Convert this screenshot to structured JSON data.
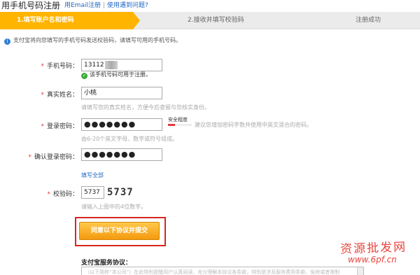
{
  "header": {
    "title": "用手机号码注册",
    "email_link": "用Email注册",
    "separator": "|",
    "help_link": "使用遇到问题?"
  },
  "steps": [
    {
      "label": "1.填写账户名和密码",
      "active": true
    },
    {
      "label": "2.接收并填写校验码",
      "active": false
    },
    {
      "label": "注册成功",
      "active": false
    }
  ],
  "notice": {
    "icon": "info-icon",
    "text": "支付宝将向您填写的手机号码发送校验码，请填写可用的手机号码。"
  },
  "form": {
    "phone": {
      "label": "手机号码：",
      "value": "13112",
      "ok_text": "该手机号码可用于注册。"
    },
    "name": {
      "label": "真实姓名：",
      "value": "小桃",
      "hint": "请填写您的真实姓名，方便今后查留与您核实身份。"
    },
    "password": {
      "label": "登录密码：",
      "value": "●●●●●●●",
      "strength_label": "安全程度",
      "strength_level": 0.3,
      "hint_side": "建议您增加密码字数并使用中英文混合的密码。",
      "hint": "由6-20个英文字母、数字或符号组成。"
    },
    "confirm": {
      "label": "确认登录密码：",
      "value": "●●●●●●●"
    },
    "fill_all_link": "填写全部",
    "captcha": {
      "label": "校验码：",
      "value": "5737",
      "image_text": "5737",
      "hint": "请输入上图中的4位数字。"
    }
  },
  "submit": {
    "label": "同意以下协议并提交"
  },
  "agreement": {
    "title": "支付宝服务协议：",
    "text": "（以下简称“本公司”）在此特别提醒用户认真阅读、充分理解本协议各条款，特别是涉及服务费用条款、免除或者限制"
  },
  "watermark": {
    "text": "资源批发网",
    "url": "www.6pf.cn"
  }
}
